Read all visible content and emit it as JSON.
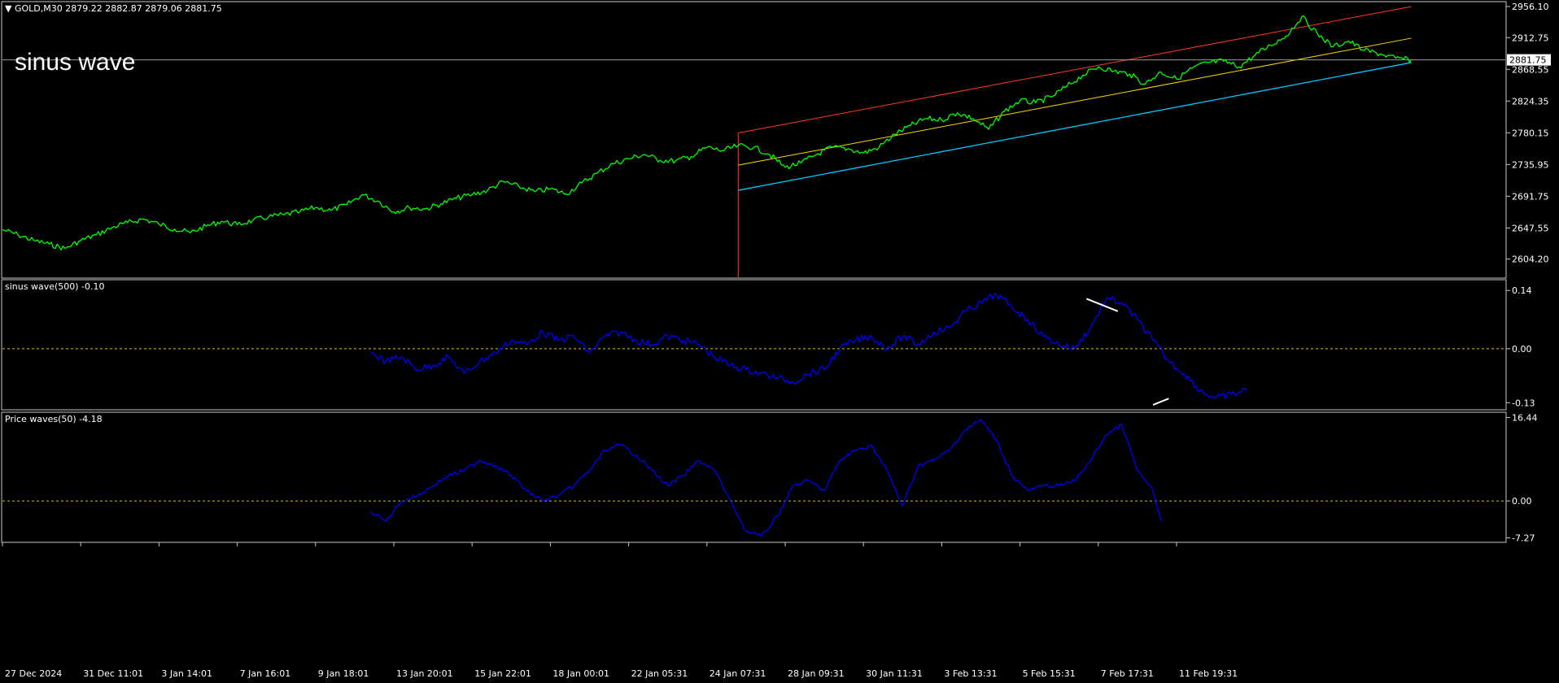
{
  "symbol_header": {
    "arrow": "▼",
    "text": "GOLD,M30  2879.22 2882.87 2879.06 2881.75"
  },
  "overlay_title": "sinus wave",
  "colors": {
    "background": "#000000",
    "frame": "#c8c8c8",
    "price": "#00ff00",
    "indicator": "#0000ff",
    "channel_top": "#ff3b1f",
    "channel_mid": "#ffd700",
    "channel_bottom": "#00c8ff",
    "level_line": "#e0c000",
    "trend_marks": "#ffffff",
    "text": "#ffffff"
  },
  "chart_data": [
    {
      "type": "line",
      "name": "price",
      "ylim": [
        2580.0,
        2956.1
      ],
      "yticks": [
        "2956.10",
        "2912.75",
        "2868.55",
        "2824.35",
        "2780.15",
        "2735.95",
        "2691.75",
        "2647.55",
        "2604.20"
      ],
      "current_price": "2881.75",
      "series": [
        {
          "points": [
            [
              0,
              2645
            ],
            [
              2,
              2638
            ],
            [
              4,
              2630
            ],
            [
              6,
              2625
            ],
            [
              8,
              2619
            ],
            [
              10,
              2630
            ],
            [
              12,
              2638
            ],
            [
              14,
              2648
            ],
            [
              16,
              2655
            ],
            [
              18,
              2660
            ],
            [
              20,
              2653
            ],
            [
              22,
              2646
            ],
            [
              24,
              2641
            ],
            [
              26,
              2650
            ],
            [
              28,
              2657
            ],
            [
              30,
              2652
            ],
            [
              32,
              2658
            ],
            [
              34,
              2663
            ],
            [
              36,
              2666
            ],
            [
              38,
              2670
            ],
            [
              40,
              2676
            ],
            [
              42,
              2672
            ],
            [
              44,
              2680
            ],
            [
              46,
              2694
            ],
            [
              48,
              2685
            ],
            [
              50,
              2670
            ],
            [
              52,
              2676
            ],
            [
              54,
              2674
            ],
            [
              56,
              2681
            ],
            [
              58,
              2689
            ],
            [
              60,
              2694
            ],
            [
              62,
              2700
            ],
            [
              64,
              2712
            ],
            [
              66,
              2705
            ],
            [
              68,
              2698
            ],
            [
              70,
              2702
            ],
            [
              72,
              2695
            ],
            [
              74,
              2710
            ],
            [
              76,
              2724
            ],
            [
              78,
              2737
            ],
            [
              80,
              2744
            ],
            [
              82,
              2750
            ],
            [
              84,
              2742
            ],
            [
              86,
              2741
            ],
            [
              88,
              2747
            ],
            [
              90,
              2760
            ],
            [
              92,
              2755
            ],
            [
              94,
              2762
            ],
            [
              96,
              2760
            ],
            [
              98,
              2750
            ],
            [
              100,
              2732
            ],
            [
              102,
              2738
            ],
            [
              104,
              2750
            ],
            [
              106,
              2760
            ],
            [
              108,
              2758
            ],
            [
              110,
              2752
            ],
            [
              112,
              2760
            ],
            [
              114,
              2778
            ],
            [
              116,
              2790
            ],
            [
              118,
              2800
            ],
            [
              120,
              2798
            ],
            [
              122,
              2808
            ],
            [
              124,
              2800
            ],
            [
              126,
              2785
            ],
            [
              128,
              2810
            ],
            [
              130,
              2825
            ],
            [
              132,
              2822
            ],
            [
              134,
              2830
            ],
            [
              136,
              2845
            ],
            [
              138,
              2860
            ],
            [
              140,
              2872
            ],
            [
              142,
              2866
            ],
            [
              144,
              2862
            ],
            [
              146,
              2848
            ],
            [
              148,
              2865
            ],
            [
              150,
              2855
            ],
            [
              152,
              2870
            ],
            [
              154,
              2878
            ],
            [
              156,
              2880
            ],
            [
              158,
              2872
            ],
            [
              160,
              2888
            ],
            [
              162,
              2902
            ],
            [
              164,
              2915
            ],
            [
              166,
              2942
            ],
            [
              168,
              2918
            ],
            [
              170,
              2900
            ],
            [
              172,
              2908
            ],
            [
              174,
              2895
            ],
            [
              176,
              2890
            ],
            [
              178,
              2884
            ],
            [
              180,
              2881.75
            ]
          ]
        }
      ],
      "channel": {
        "x_range": [
          94,
          180
        ],
        "top": [
          2780,
          2956
        ],
        "middle": [
          2735,
          2912
        ],
        "bottom": [
          2700,
          2878
        ]
      },
      "start_line_x": 94
    },
    {
      "type": "line",
      "name": "sinus wave(500) -0.10",
      "ylim": [
        -0.145,
        0.16
      ],
      "yticks": [
        "0.14",
        "0.00",
        "-0.13"
      ],
      "level": 0.0,
      "series": [
        {
          "points": [
            [
              47,
              -0.01
            ],
            [
              49,
              -0.03
            ],
            [
              51,
              -0.02
            ],
            [
              53,
              -0.05
            ],
            [
              55,
              -0.04
            ],
            [
              57,
              -0.02
            ],
            [
              59,
              -0.06
            ],
            [
              61,
              -0.03
            ],
            [
              63,
              -0.01
            ],
            [
              65,
              0.02
            ],
            [
              67,
              0.01
            ],
            [
              69,
              0.04
            ],
            [
              71,
              0.02
            ],
            [
              73,
              0.03
            ],
            [
              75,
              -0.01
            ],
            [
              77,
              0.03
            ],
            [
              79,
              0.04
            ],
            [
              81,
              0.02
            ],
            [
              83,
              0.01
            ],
            [
              85,
              0.03
            ],
            [
              87,
              0.02
            ],
            [
              89,
              0.01
            ],
            [
              91,
              -0.02
            ],
            [
              93,
              -0.04
            ],
            [
              95,
              -0.05
            ],
            [
              97,
              -0.06
            ],
            [
              99,
              -0.07
            ],
            [
              101,
              -0.08
            ],
            [
              103,
              -0.06
            ],
            [
              105,
              -0.05
            ],
            [
              107,
              0.0
            ],
            [
              109,
              0.02
            ],
            [
              111,
              0.03
            ],
            [
              113,
              0.0
            ],
            [
              115,
              0.03
            ],
            [
              117,
              0.01
            ],
            [
              119,
              0.04
            ],
            [
              121,
              0.05
            ],
            [
              123,
              0.09
            ],
            [
              125,
              0.11
            ],
            [
              127,
              0.13
            ],
            [
              129,
              0.1
            ],
            [
              131,
              0.07
            ],
            [
              133,
              0.03
            ],
            [
              135,
              0.01
            ],
            [
              137,
              0.0
            ],
            [
              139,
              0.05
            ],
            [
              141,
              0.12
            ],
            [
              143,
              0.11
            ],
            [
              145,
              0.07
            ],
            [
              147,
              0.02
            ],
            [
              149,
              -0.03
            ],
            [
              151,
              -0.06
            ],
            [
              153,
              -0.1
            ],
            [
              155,
              -0.12
            ],
            [
              157,
              -0.11
            ],
            [
              159,
              -0.1
            ]
          ]
        }
      ],
      "trend_marks": [
        {
          "from": [
            138.5,
            0.12
          ],
          "to": [
            142.5,
            0.09
          ]
        },
        {
          "from": [
            147,
            -0.135
          ],
          "to": [
            149,
            -0.12
          ]
        }
      ]
    },
    {
      "type": "line",
      "name": "Price waves(50) -4.18",
      "ylim": [
        -8.0,
        17.0
      ],
      "yticks": [
        "16.44",
        "0.00",
        "-7.27"
      ],
      "level": 0.0,
      "series": [
        {
          "points": [
            [
              47,
              -2
            ],
            [
              49,
              -4
            ],
            [
              51,
              0
            ],
            [
              53,
              1
            ],
            [
              55,
              3
            ],
            [
              57,
              5
            ],
            [
              59,
              6
            ],
            [
              61,
              8
            ],
            [
              63,
              7
            ],
            [
              65,
              5
            ],
            [
              67,
              2
            ],
            [
              69,
              0
            ],
            [
              71,
              1
            ],
            [
              73,
              3
            ],
            [
              75,
              6
            ],
            [
              77,
              10
            ],
            [
              79,
              11
            ],
            [
              81,
              9
            ],
            [
              83,
              6
            ],
            [
              85,
              3
            ],
            [
              87,
              5
            ],
            [
              89,
              8
            ],
            [
              91,
              6
            ],
            [
              93,
              0
            ],
            [
              95,
              -6
            ],
            [
              97,
              -7
            ],
            [
              99,
              -3
            ],
            [
              101,
              3
            ],
            [
              103,
              4
            ],
            [
              105,
              2
            ],
            [
              107,
              8
            ],
            [
              109,
              10
            ],
            [
              111,
              11
            ],
            [
              113,
              6
            ],
            [
              115,
              -1
            ],
            [
              117,
              7
            ],
            [
              119,
              8
            ],
            [
              121,
              10
            ],
            [
              123,
              14
            ],
            [
              125,
              16
            ],
            [
              127,
              12
            ],
            [
              129,
              5
            ],
            [
              131,
              2
            ],
            [
              133,
              3
            ],
            [
              135,
              3
            ],
            [
              137,
              4
            ],
            [
              139,
              8
            ],
            [
              141,
              13
            ],
            [
              143,
              15
            ],
            [
              145,
              6
            ],
            [
              147,
              2
            ],
            [
              148,
              -4
            ]
          ]
        }
      ]
    }
  ],
  "x_axis": {
    "labels": [
      {
        "x": 0,
        "text": "27 Dec 2024"
      },
      {
        "x": 10,
        "text": "31 Dec 11:01"
      },
      {
        "x": 20,
        "text": "3 Jan 14:01"
      },
      {
        "x": 30,
        "text": "7 Jan 16:01"
      },
      {
        "x": 40,
        "text": "9 Jan 18:01"
      },
      {
        "x": 50,
        "text": "13 Jan 20:01"
      },
      {
        "x": 60,
        "text": "15 Jan 22:01"
      },
      {
        "x": 70,
        "text": "18 Jan 00:01"
      },
      {
        "x": 80,
        "text": "22 Jan 05:31"
      },
      {
        "x": 90,
        "text": "24 Jan 07:31"
      },
      {
        "x": 100,
        "text": "28 Jan 09:31"
      },
      {
        "x": 110,
        "text": "30 Jan 11:31"
      },
      {
        "x": 120,
        "text": "3 Feb 13:31"
      },
      {
        "x": 130,
        "text": "5 Feb 15:31"
      },
      {
        "x": 140,
        "text": "7 Feb 17:31"
      },
      {
        "x": 150,
        "text": "11 Feb 19:31"
      }
    ]
  }
}
